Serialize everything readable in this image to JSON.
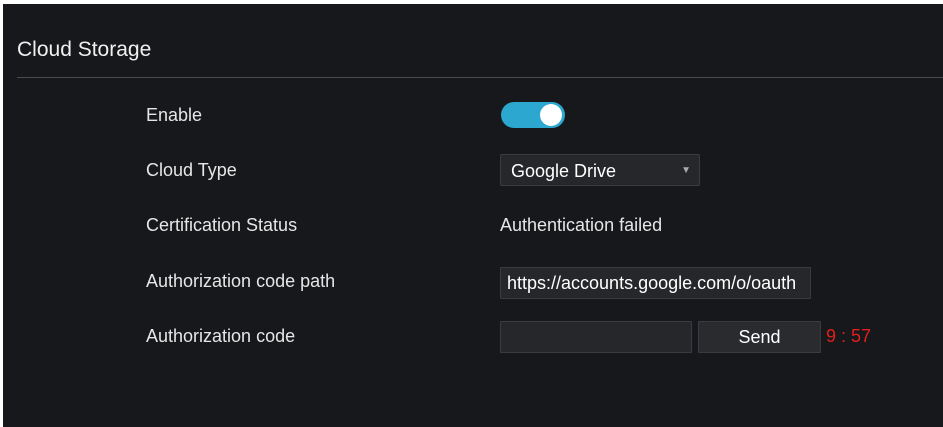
{
  "panel": {
    "title": "Cloud Storage"
  },
  "rows": {
    "enable": {
      "label": "Enable",
      "toggle_on": true
    },
    "cloud_type": {
      "label": "Cloud Type",
      "selected": "Google Drive"
    },
    "certification_status": {
      "label": "Certification Status",
      "value": "Authentication failed"
    },
    "auth_code_path": {
      "label": "Authorization code path",
      "value": "https://accounts.google.com/o/oauth"
    },
    "auth_code": {
      "label": "Authorization code",
      "value": "",
      "send_label": "Send",
      "countdown": "9 : 57"
    }
  },
  "colors": {
    "background": "#17181b",
    "accent": "#2ba7d0",
    "countdown": "#e0201c"
  },
  "icons": {
    "dropdown": "caret-down-icon"
  }
}
